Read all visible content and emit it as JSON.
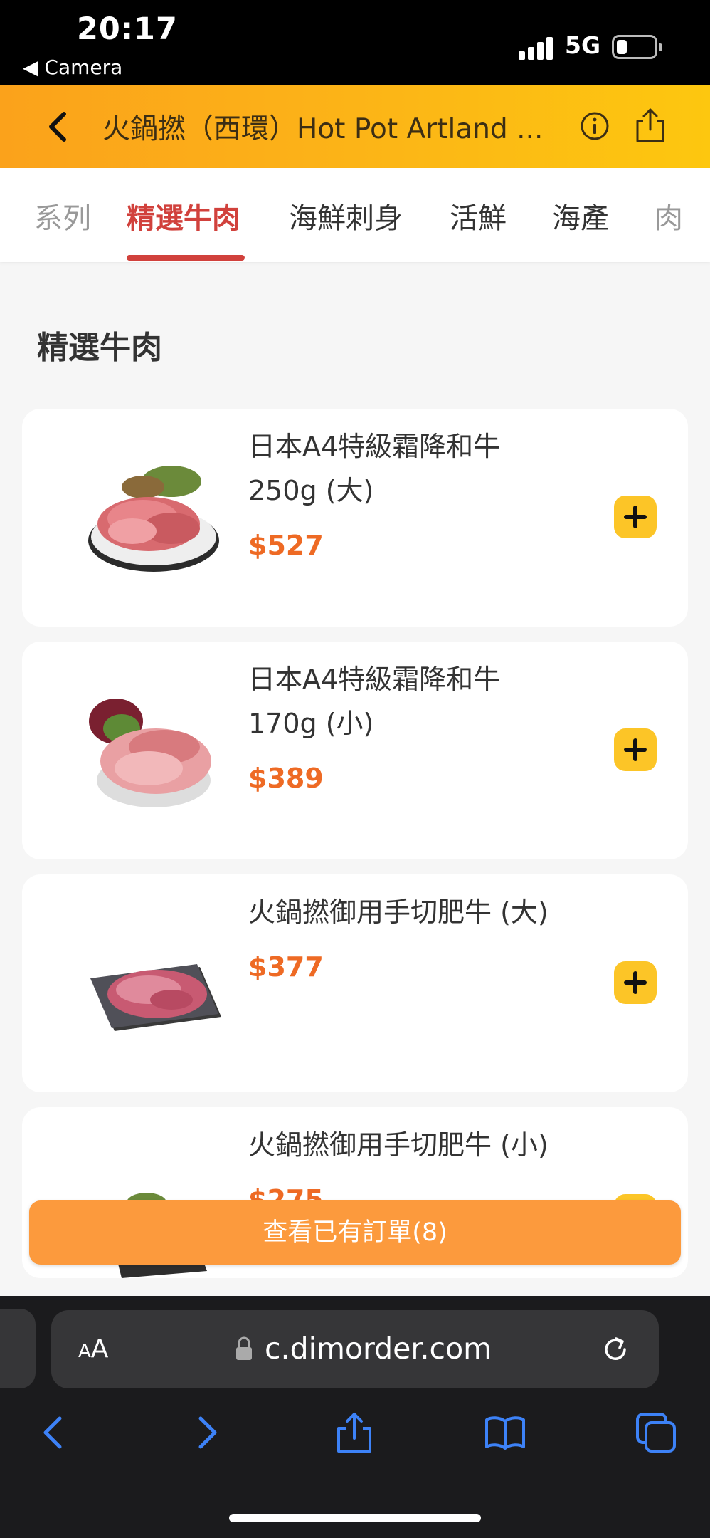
{
  "status_bar": {
    "time": "20:17",
    "back_app": "◀ Camera",
    "network": "5G"
  },
  "header": {
    "title": "火鍋撚（西環）Hot Pot Artland ..."
  },
  "tabs": [
    {
      "label": "系列",
      "state": "partial"
    },
    {
      "label": "精選牛肉",
      "state": "active"
    },
    {
      "label": "海鮮刺身",
      "state": "normal"
    },
    {
      "label": "活鮮",
      "state": "normal"
    },
    {
      "label": "海產",
      "state": "normal"
    },
    {
      "label": "肉",
      "state": "partial"
    }
  ],
  "section": {
    "title": "精選牛肉"
  },
  "items": [
    {
      "name_line1": "日本A4特級霜降和牛",
      "name_line2": "250g (大)",
      "price": "$527"
    },
    {
      "name_line1": "日本A4特級霜降和牛",
      "name_line2": "170g (小)",
      "price": "$389"
    },
    {
      "name_line1": "火鍋撚御用手切肥牛 (大)",
      "name_line2": "",
      "price": "$377"
    },
    {
      "name_line1": "火鍋撚御用手切肥牛 (小)",
      "name_line2": "",
      "price": "$275"
    }
  ],
  "order_button": {
    "label": "查看已有訂單(8)"
  },
  "browser": {
    "aa_label": "AA",
    "url": "c.dimorder.com"
  },
  "colors": {
    "accent": "#d1413c",
    "price": "#ee6a24",
    "add_button": "#fcc527",
    "order_button": "#fc9a3d",
    "header_start": "#fba21b",
    "header_end": "#fdc70f"
  }
}
